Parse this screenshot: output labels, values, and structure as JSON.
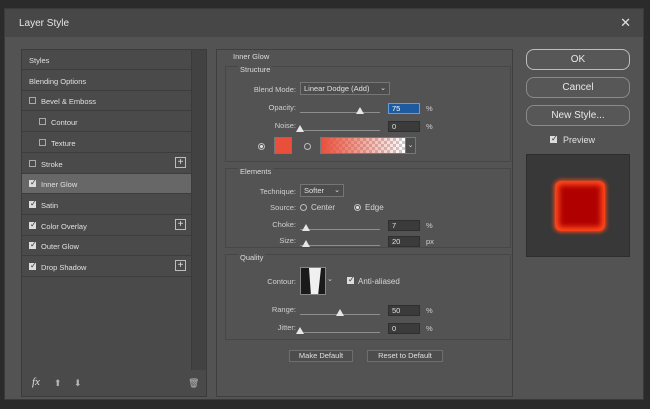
{
  "window": {
    "title": "Layer Style",
    "close_glyph": "✕"
  },
  "styles_list": {
    "items": [
      {
        "label": "Styles",
        "checkbox": false,
        "checked": false,
        "plus": false,
        "selected": false,
        "indent": 0
      },
      {
        "label": "Blending Options",
        "checkbox": false,
        "checked": false,
        "plus": false,
        "selected": false,
        "indent": 0
      },
      {
        "label": "Bevel & Emboss",
        "checkbox": true,
        "checked": false,
        "plus": false,
        "selected": false,
        "indent": 0
      },
      {
        "label": "Contour",
        "checkbox": true,
        "checked": false,
        "plus": false,
        "selected": false,
        "indent": 1
      },
      {
        "label": "Texture",
        "checkbox": true,
        "checked": false,
        "plus": false,
        "selected": false,
        "indent": 1
      },
      {
        "label": "Stroke",
        "checkbox": true,
        "checked": false,
        "plus": true,
        "selected": false,
        "indent": 0
      },
      {
        "label": "Inner Glow",
        "checkbox": true,
        "checked": true,
        "plus": false,
        "selected": true,
        "indent": 0
      },
      {
        "label": "Satin",
        "checkbox": true,
        "checked": true,
        "plus": false,
        "selected": false,
        "indent": 0
      },
      {
        "label": "Color Overlay",
        "checkbox": true,
        "checked": true,
        "plus": true,
        "selected": false,
        "indent": 0
      },
      {
        "label": "Outer Glow",
        "checkbox": true,
        "checked": true,
        "plus": false,
        "selected": false,
        "indent": 0
      },
      {
        "label": "Drop Shadow",
        "checkbox": true,
        "checked": true,
        "plus": true,
        "selected": false,
        "indent": 0
      }
    ],
    "bottom_icons": [
      "fx-icon",
      "arrow-up-icon",
      "arrow-down-icon",
      "trash-icon"
    ],
    "fx_label": "fx"
  },
  "inner_glow": {
    "title": "Inner Glow",
    "structure": {
      "title": "Structure",
      "blend_mode_label": "Blend Mode:",
      "blend_mode_value": "Linear Dodge (Add)",
      "opacity_label": "Opacity:",
      "opacity_value": "75",
      "opacity_percent": 75,
      "noise_label": "Noise:",
      "noise_value": "0",
      "noise_percent": 0,
      "unit_percent": "%",
      "color_swatch": "#e8503c",
      "gradient_from": "#e8503c"
    },
    "elements": {
      "title": "Elements",
      "technique_label": "Technique:",
      "technique_value": "Softer",
      "source_label": "Source:",
      "source_center": "Center",
      "source_edge": "Edge",
      "choke_label": "Choke:",
      "choke_value": "7",
      "choke_percent": 7,
      "size_label": "Size:",
      "size_value": "20",
      "size_fraction": 0.08,
      "unit_percent": "%",
      "unit_px": "px"
    },
    "quality": {
      "title": "Quality",
      "contour_label": "Contour:",
      "anti_aliased_label": "Anti-aliased",
      "range_label": "Range:",
      "range_value": "50",
      "range_percent": 50,
      "jitter_label": "Jitter:",
      "jitter_value": "0",
      "jitter_percent": 0,
      "unit_percent": "%"
    },
    "make_default": "Make Default",
    "reset_default": "Reset to Default"
  },
  "actions": {
    "ok": "OK",
    "cancel": "Cancel",
    "new_style": "New Style...",
    "preview_label": "Preview"
  },
  "colors": {
    "accent": "#1e5aa0",
    "glow": "#ff4a1c",
    "glow_inner": "#b00000"
  }
}
